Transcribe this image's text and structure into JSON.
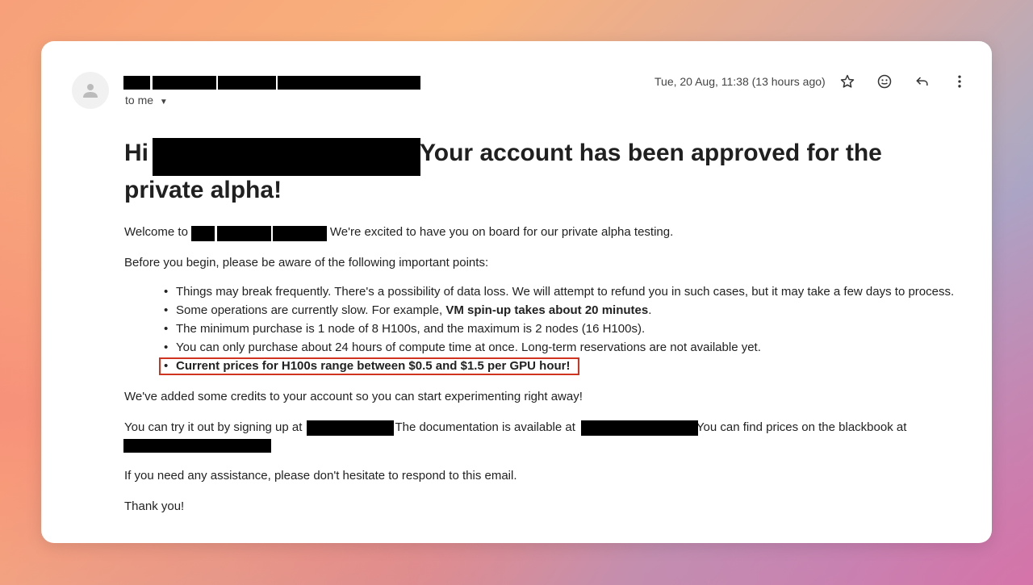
{
  "email": {
    "recipient_label": "to me",
    "date": "Tue, 20 Aug, 11:38 (13 hours ago)",
    "icons": [
      "star-icon",
      "emoji-icon",
      "reply-icon",
      "more-vert-icon"
    ],
    "heading_prefix": "Hi",
    "heading_rest": "Your account has been approved for the",
    "heading_line2": "private alpha!",
    "welcome_prefix": "Welcome to",
    "welcome_rest": "We're excited to have you on board for our private alpha testing.",
    "intro": "Before you begin, please be aware of the following important points:",
    "bullets": [
      {
        "text": "Things may break frequently. There's a possibility of data loss. We will attempt to refund you in such cases, but it may take a few days to process."
      },
      {
        "text": "Some operations are currently slow. For example, ",
        "bold": "VM spin-up takes about 20 minutes",
        "after": "."
      },
      {
        "text": "The minimum purchase is 1 node of 8 H100s, and the maximum is 2 nodes (16 H100s)."
      },
      {
        "text": "You can only purchase about 24 hours of compute time at once. Long-term reservations are not available yet."
      },
      {
        "bold": "Current prices for H100s range between $0.5 and $1.5 per GPU hour!"
      }
    ],
    "credits": "We've added some credits to your account so you can start experimenting right away!",
    "try_prefix": "You can try it out by signing up at",
    "docs_prefix": "The documentation is available at",
    "prices_prefix": "You can find prices on the blackbook at",
    "assist": "If you need any assistance, please don't hesitate to respond to this email.",
    "thanks": "Thank you!",
    "highlight_color": "#d0331f"
  }
}
